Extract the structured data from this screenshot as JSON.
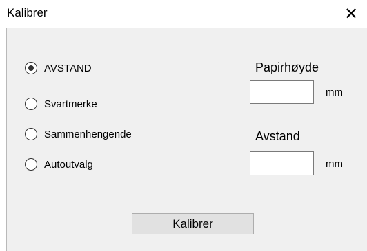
{
  "window": {
    "title": "Kalibrer",
    "close_glyph": "✕"
  },
  "options": {
    "selected": 0,
    "items": [
      {
        "label": "AVSTAND",
        "checked": true
      },
      {
        "label": "Svartmerke",
        "checked": false
      },
      {
        "label": "Sammenhengende",
        "checked": false
      },
      {
        "label": "Autoutvalg",
        "checked": false
      }
    ]
  },
  "paper_height": {
    "label": "Papirhøyde",
    "value": "",
    "unit": "mm"
  },
  "distance": {
    "label": "Avstand",
    "value": "",
    "unit": "mm"
  },
  "calibrate_button": {
    "label": "Kalibrer"
  }
}
